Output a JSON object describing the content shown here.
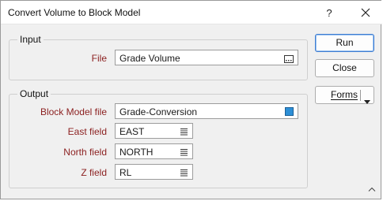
{
  "window": {
    "title": "Convert Volume to Block Model",
    "help_label": "?"
  },
  "input_group": {
    "title": "Input",
    "file_label": "File",
    "file_value": "Grade Volume"
  },
  "output_group": {
    "title": "Output",
    "block_model_label": "Block Model file",
    "block_model_value": "Grade-Conversion",
    "east_label": "East field",
    "east_value": "EAST",
    "north_label": "North field",
    "north_value": "NORTH",
    "z_label": "Z field",
    "z_value": "RL"
  },
  "buttons": {
    "run": "Run",
    "close": "Close",
    "forms": "Forms"
  },
  "colors": {
    "label_color": "#8b1f1f",
    "primary_border": "#3e7dd1",
    "block_model_swatch": "#2d8fd6"
  }
}
